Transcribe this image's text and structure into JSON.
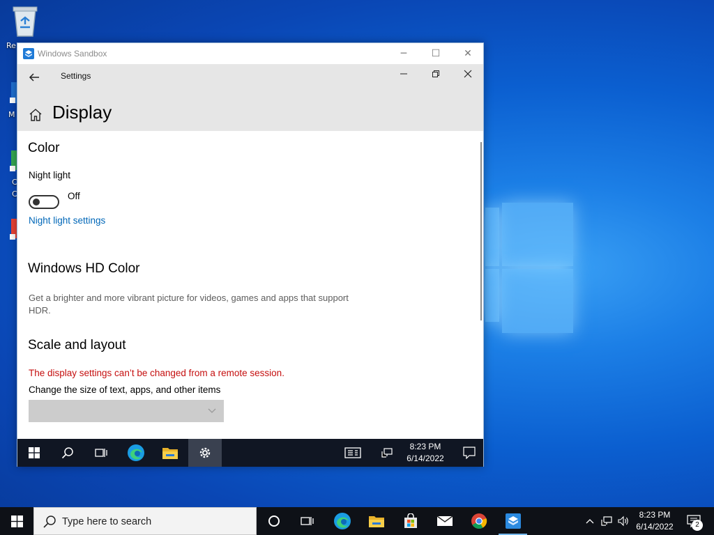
{
  "desktop": {
    "icon_labels": [
      "Re",
      "M",
      "C",
      "C",
      ""
    ]
  },
  "sandbox_window": {
    "title": "Windows Sandbox",
    "controls": {
      "minimize": "─",
      "maximize": "☐",
      "close": "✕"
    }
  },
  "settings": {
    "app_name": "Settings",
    "page_title": "Display",
    "sections": {
      "color": {
        "heading": "Color",
        "night_light_label": "Night light",
        "night_light_state": "Off",
        "night_light_link": "Night light settings"
      },
      "hdr": {
        "heading": "Windows HD Color",
        "description": "Get a brighter and more vibrant picture for videos, games and apps that support HDR."
      },
      "scale": {
        "heading": "Scale and layout",
        "warning": "The display settings can’t be changed from a remote session.",
        "size_label": "Change the size of text, apps, and other items",
        "size_value": ""
      }
    }
  },
  "inner_taskbar": {
    "time": "8:23 PM",
    "date": "6/14/2022"
  },
  "taskbar": {
    "search_placeholder": "Type here to search",
    "time": "8:23 PM",
    "date": "6/14/2022",
    "notification_count": "2"
  },
  "colors": {
    "accent_link": "#0067b8",
    "warning": "#c50f0f",
    "header_bg": "#e6e6e6",
    "taskbar_bg": "#0e1117"
  }
}
